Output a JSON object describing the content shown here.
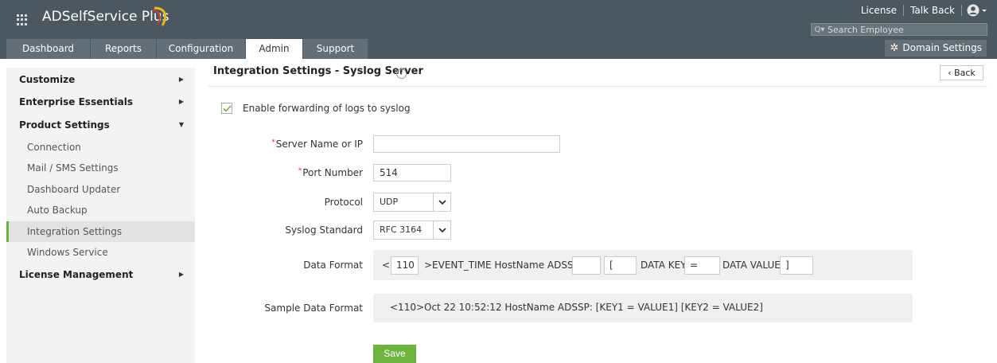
{
  "header": {
    "app_name": "ADSelfService Plus",
    "license_link": "License",
    "talkback_link": "Talk Back",
    "search_placeholder": "Search Employee"
  },
  "nav": {
    "tabs": [
      {
        "label": "Dashboard"
      },
      {
        "label": "Reports"
      },
      {
        "label": "Configuration"
      },
      {
        "label": "Admin"
      },
      {
        "label": "Support"
      }
    ],
    "active_tab": "Admin",
    "domain_settings": "Domain Settings"
  },
  "sidebar": {
    "items": [
      {
        "label": "Customize"
      },
      {
        "label": "Enterprise Essentials"
      },
      {
        "label": "Product Settings"
      },
      {
        "label": "License Management"
      }
    ],
    "product_settings_sub": [
      {
        "label": "Connection"
      },
      {
        "label": "Mail / SMS Settings"
      },
      {
        "label": "Dashboard Updater"
      },
      {
        "label": "Auto Backup"
      },
      {
        "label": "Integration Settings"
      },
      {
        "label": "Windows Service"
      }
    ],
    "active_sub": "Integration Settings"
  },
  "main": {
    "title": "Integration Settings - Syslog Server",
    "back_label": "Back",
    "enable_label": "Enable forwarding of logs to syslog",
    "enable_checked": true,
    "fields": {
      "server_label": "Server Name or IP",
      "server_value": "",
      "port_label": "Port Number",
      "port_value": "514",
      "protocol_label": "Protocol",
      "protocol_value": "UDP",
      "standard_label": "Syslog Standard",
      "standard_value": "RFC 3164",
      "data_format_label": "Data Format",
      "sample_label": "Sample Data Format"
    },
    "data_format": {
      "open_bracket": "<",
      "priority_value": "110",
      "middle_text": ">EVENT_TIME HostName ADSSP:",
      "prefix_value": "",
      "bracket_value": "[",
      "key_label": "DATA KEY",
      "separator_value": "=",
      "value_label": "DATA VALUE",
      "close_value": "]"
    },
    "sample_text": "<110>Oct 22 10:52:12 HostName ADSSP: [KEY1 = VALUE1] [KEY2 = VALUE2]",
    "save_label": "Save"
  },
  "colors": {
    "header_bg": "#4c575f",
    "accent_green": "#6db33f",
    "required_red": "#e3322c"
  }
}
